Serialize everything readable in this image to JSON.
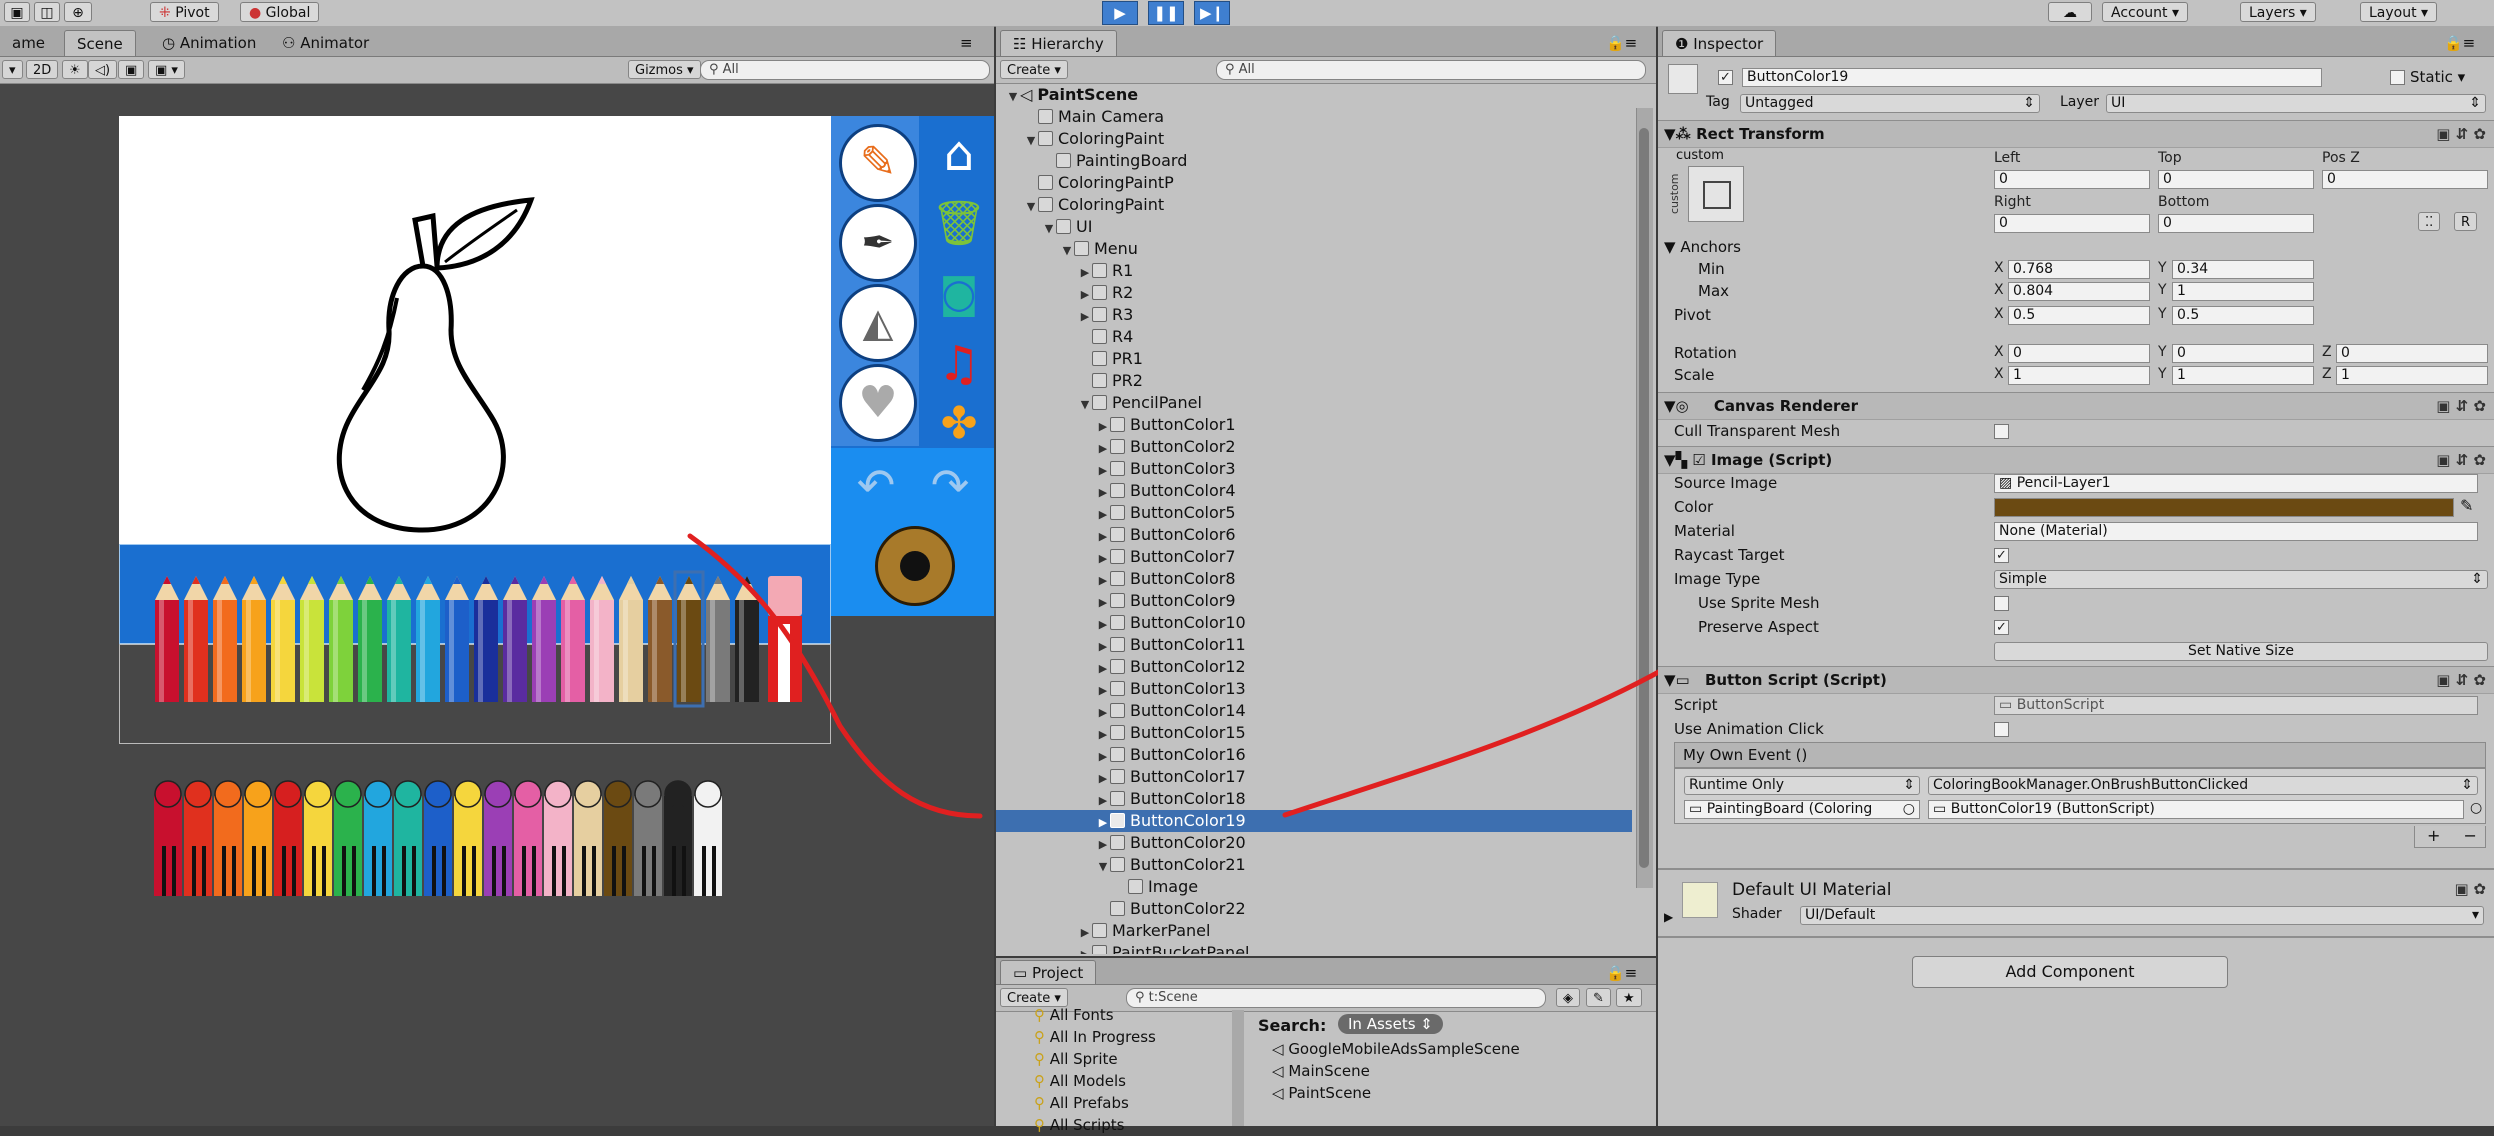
{
  "toolbar": {
    "pivot": "Pivot",
    "global": "Global",
    "account": "Account",
    "layers": "Layers",
    "layout": "Layout"
  },
  "scene": {
    "tabs": [
      "ame",
      "Scene",
      "Animation",
      "Animator"
    ],
    "mode2d": "2D",
    "gizmos": "Gizmos",
    "search_placeholder": "All"
  },
  "hierarchy": {
    "title": "Hierarchy",
    "create": "Create",
    "search_placeholder": "All",
    "items": [
      {
        "label": "PaintScene",
        "indent": 0,
        "arrow": "▼",
        "bold": true
      },
      {
        "label": "Main Camera",
        "indent": 1,
        "arrow": ""
      },
      {
        "label": "ColoringPaint",
        "indent": 1,
        "arrow": "▼"
      },
      {
        "label": "PaintingBoard",
        "indent": 2,
        "arrow": ""
      },
      {
        "label": "ColoringPaintP",
        "indent": 1,
        "arrow": ""
      },
      {
        "label": "ColoringPaint",
        "indent": 1,
        "arrow": "▼"
      },
      {
        "label": "UI",
        "indent": 2,
        "arrow": "▼"
      },
      {
        "label": "Menu",
        "indent": 3,
        "arrow": "▼"
      },
      {
        "label": "R1",
        "indent": 4,
        "arrow": "▶"
      },
      {
        "label": "R2",
        "indent": 4,
        "arrow": "▶"
      },
      {
        "label": "R3",
        "indent": 4,
        "arrow": "▶"
      },
      {
        "label": "R4",
        "indent": 4,
        "arrow": ""
      },
      {
        "label": "PR1",
        "indent": 4,
        "arrow": ""
      },
      {
        "label": "PR2",
        "indent": 4,
        "arrow": ""
      },
      {
        "label": "PencilPanel",
        "indent": 4,
        "arrow": "▼"
      },
      {
        "label": "ButtonColor1",
        "indent": 5,
        "arrow": "▶"
      },
      {
        "label": "ButtonColor2",
        "indent": 5,
        "arrow": "▶"
      },
      {
        "label": "ButtonColor3",
        "indent": 5,
        "arrow": "▶"
      },
      {
        "label": "ButtonColor4",
        "indent": 5,
        "arrow": "▶"
      },
      {
        "label": "ButtonColor5",
        "indent": 5,
        "arrow": "▶"
      },
      {
        "label": "ButtonColor6",
        "indent": 5,
        "arrow": "▶"
      },
      {
        "label": "ButtonColor7",
        "indent": 5,
        "arrow": "▶"
      },
      {
        "label": "ButtonColor8",
        "indent": 5,
        "arrow": "▶"
      },
      {
        "label": "ButtonColor9",
        "indent": 5,
        "arrow": "▶"
      },
      {
        "label": "ButtonColor10",
        "indent": 5,
        "arrow": "▶"
      },
      {
        "label": "ButtonColor11",
        "indent": 5,
        "arrow": "▶"
      },
      {
        "label": "ButtonColor12",
        "indent": 5,
        "arrow": "▶"
      },
      {
        "label": "ButtonColor13",
        "indent": 5,
        "arrow": "▶"
      },
      {
        "label": "ButtonColor14",
        "indent": 5,
        "arrow": "▶"
      },
      {
        "label": "ButtonColor15",
        "indent": 5,
        "arrow": "▶"
      },
      {
        "label": "ButtonColor16",
        "indent": 5,
        "arrow": "▶"
      },
      {
        "label": "ButtonColor17",
        "indent": 5,
        "arrow": "▶"
      },
      {
        "label": "ButtonColor18",
        "indent": 5,
        "arrow": "▶"
      },
      {
        "label": "ButtonColor19",
        "indent": 5,
        "arrow": "▶",
        "selected": true
      },
      {
        "label": "ButtonColor20",
        "indent": 5,
        "arrow": "▶"
      },
      {
        "label": "ButtonColor21",
        "indent": 5,
        "arrow": "▼"
      },
      {
        "label": "Image",
        "indent": 6,
        "arrow": ""
      },
      {
        "label": "ButtonColor22",
        "indent": 5,
        "arrow": ""
      },
      {
        "label": "MarkerPanel",
        "indent": 4,
        "arrow": "▶"
      },
      {
        "label": "PaintBucketPanel",
        "indent": 4,
        "arrow": "▶"
      }
    ]
  },
  "project": {
    "title": "Project",
    "create": "Create",
    "search_value": "t:Scene",
    "favorites": [
      "All Fonts",
      "All In Progress",
      "All Sprite",
      "All Models",
      "All Prefabs",
      "All Scripts"
    ],
    "search_label": "Search:",
    "scope": "In Assets",
    "results": [
      "GoogleMobileAdsSampleScene",
      "MainScene",
      "PaintScene"
    ]
  },
  "inspector": {
    "title": "Inspector",
    "object_name": "ButtonColor19",
    "static_label": "Static",
    "tag_label": "Tag",
    "tag_value": "Untagged",
    "layer_label": "Layer",
    "layer_value": "UI",
    "rect_transform": {
      "title": "Rect Transform",
      "custom": "custom",
      "custom_side": "custom",
      "headers": [
        "Left",
        "Top",
        "Pos Z",
        "Right",
        "Bottom"
      ],
      "left": "0",
      "top": "0",
      "posz": "0",
      "right": "0",
      "bottom": "0",
      "anchors_label": "Anchors",
      "min_label": "Min",
      "min_x": "0.768",
      "min_y": "0.34",
      "max_label": "Max",
      "max_x": "0.804",
      "max_y": "1",
      "pivot_label": "Pivot",
      "pivot_x": "0.5",
      "pivot_y": "0.5",
      "rotation_label": "Rotation",
      "rot_x": "0",
      "rot_y": "0",
      "rot_z": "0",
      "scale_label": "Scale",
      "scale_x": "1",
      "scale_y": "1",
      "scale_z": "1",
      "r_button": "R"
    },
    "canvas_renderer": {
      "title": "Canvas Renderer",
      "cull_label": "Cull Transparent Mesh"
    },
    "image_script": {
      "title": "Image (Script)",
      "source_label": "Source Image",
      "source_value": "Pencil-Layer1",
      "color_label": "Color",
      "color_value": "#6b4a12",
      "material_label": "Material",
      "material_value": "None (Material)",
      "raycast_label": "Raycast Target",
      "image_type_label": "Image Type",
      "image_type_value": "Simple",
      "sprite_mesh_label": "Use Sprite Mesh",
      "preserve_label": "Preserve Aspect",
      "native_button": "Set Native Size"
    },
    "button_script": {
      "title": "Button Script (Script)",
      "script_label": "Script",
      "script_value": "ButtonScript",
      "anim_label": "Use Animation Click",
      "event_title": "My Own Event ()",
      "runtime": "Runtime Only",
      "function": "ColoringBookManager.OnBrushButtonClicked",
      "target": "PaintingBoard (Coloring",
      "arg": "ButtonColor19 (ButtonScript)",
      "plus": "+",
      "minus": "−"
    },
    "material": {
      "title": "Default UI Material",
      "shader_label": "Shader",
      "shader_value": "UI/Default"
    },
    "add_component": "Add Component"
  },
  "colors": {
    "selection": "#3d6fb0",
    "annotation": "#e02020",
    "menu_blue": "#1a6fd0",
    "pencils": [
      "#c8102e",
      "#e0301e",
      "#f26b1d",
      "#f7a21b",
      "#f5d63d",
      "#c9e33a",
      "#7ed23b",
      "#2bb24c",
      "#1fb5a0",
      "#22a6de",
      "#1d5fc9",
      "#1a2f9b",
      "#5a2ca0",
      "#9b3fb5",
      "#e45fa5",
      "#f3b3c8",
      "#e6cfa0",
      "#8a5a2b",
      "#6b4a12",
      "#7a7a7a",
      "#222222",
      "#f2f2f2"
    ],
    "crayons": [
      "#c8102e",
      "#e0301e",
      "#f26b1d",
      "#f7a21b",
      "#d61f1f",
      "#f5d63d",
      "#2bb24c",
      "#22a6de",
      "#1fb5a0",
      "#1d5fc9",
      "#f5d63d",
      "#9b3fb5",
      "#e45fa5",
      "#f3b3c8",
      "#e6cfa0",
      "#6b4a12",
      "#7a7a7a",
      "#222222",
      "#f2f2f2"
    ]
  }
}
